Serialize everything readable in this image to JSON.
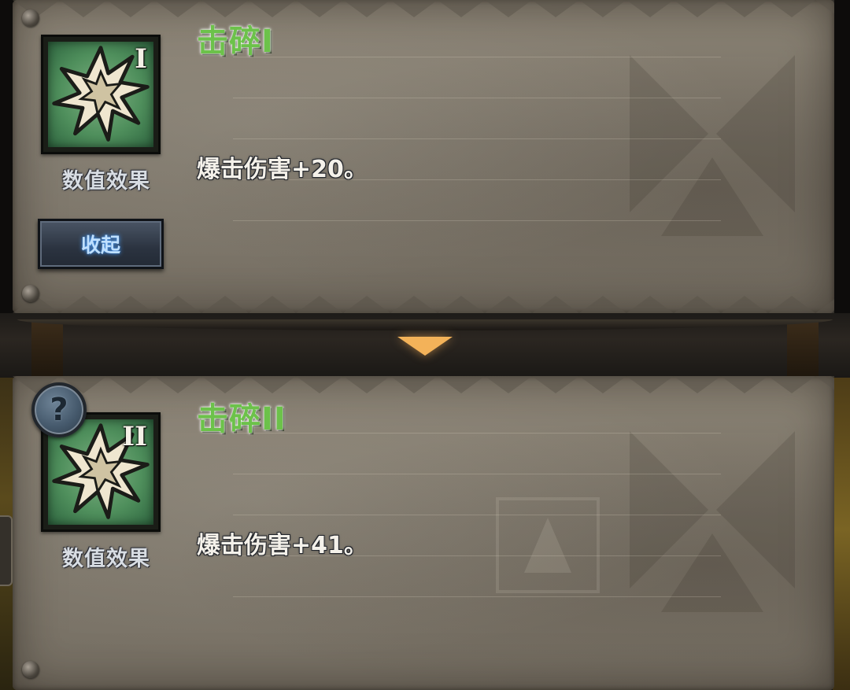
{
  "skills": [
    {
      "tier": "I",
      "name": "击碎I",
      "category": "数值效果",
      "description": "爆击伤害+20。"
    },
    {
      "tier": "II",
      "name": "击碎II",
      "category": "数值效果",
      "description": "爆击伤害+41。"
    }
  ],
  "collapse_button": {
    "label": "收起"
  },
  "help_button": {
    "label": "?"
  },
  "colors": {
    "skill_name_green": "#6cc24a",
    "icon_green": "#4f8f5c",
    "arrow_orange": "#f3b259",
    "parchment": "#7d766a"
  }
}
